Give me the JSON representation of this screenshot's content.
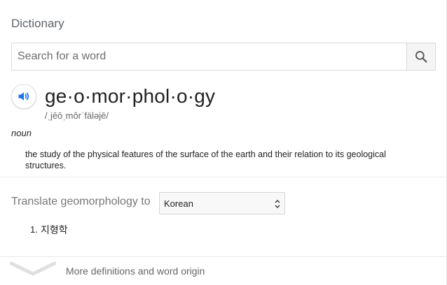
{
  "dictionary": {
    "title": "Dictionary",
    "search": {
      "placeholder": "Search for a word",
      "value": ""
    },
    "entry": {
      "headword": "ge·o·mor·phol·o·gy",
      "phonetic": "/ˌjēōˌmôrˈfäləjē/",
      "part_of_speech": "noun",
      "definition": "the study of the physical features of the surface of the earth and their relation to its geological structures."
    },
    "translate": {
      "label": "Translate geomorphology to",
      "selected_language": "Korean",
      "results": [
        {
          "number": "1.",
          "text": "지형학"
        }
      ]
    },
    "more": {
      "label": "More definitions and word origin"
    }
  },
  "colors": {
    "accent_blue": "#1a73e8",
    "muted_text": "#777777",
    "divider": "#ececec"
  }
}
